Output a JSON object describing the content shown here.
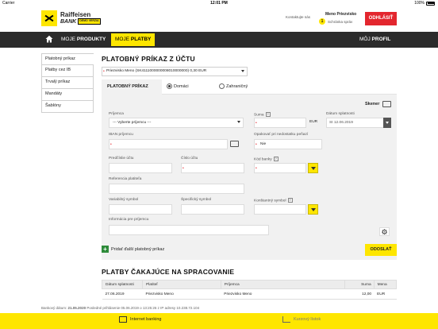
{
  "statusbar": {
    "carrier": "Carrier",
    "time": "12:01 PM",
    "battery": "100%"
  },
  "brand": {
    "line1": "Raiffeisen",
    "line2": "BANK",
    "badge": "DEMO VERZIA"
  },
  "header": {
    "contact": "Kontaktujte nás",
    "user_name": "Meno Priezvisko",
    "message_count": "1",
    "inbox": "Schránka správ",
    "logout": "ODHLÁSIŤ"
  },
  "nav": {
    "products_prefix": "MOJE",
    "products_bold": "PRODUKTY",
    "payments_prefix": "MOJE",
    "payments_bold": "PLATBY",
    "profile_prefix": "MÔJ",
    "profile_bold": "PROFIL"
  },
  "sidebar": {
    "items": [
      {
        "label": "Platobný príkaz"
      },
      {
        "label": "Platby cez IB"
      },
      {
        "label": "Trvalý príkaz"
      },
      {
        "label": "Mandáty"
      },
      {
        "label": "Šablóny"
      }
    ]
  },
  "main": {
    "title": "PLATOBNÝ PRÍKAZ Z ÚČTU",
    "account": "Priezvisko Meno (SK4111000000008010000000) 0,30 EUR",
    "form_tab": "PLATOBNÝ PRÍKAZ",
    "radio_domestic": "Domáci",
    "radio_foreign": "Zahraničný",
    "scanner": "Skener",
    "recipient_label": "Príjemca",
    "recipient_value": "--- Vyberte príjemcu ---",
    "iban_label": "IBAN príjemcu",
    "prefix_label": "Predčíslie účtu",
    "account_number_label": "Číslo účtu",
    "bank_code_label": "Kód banky",
    "reference_label": "Referencia platiteľa",
    "variable_symbol_label": "Variabilný symbol",
    "specific_symbol_label": "Špecifický symbol",
    "constant_symbol_label": "Konštantný symbol",
    "info_label": "Informácia pre príjemcu",
    "amount_label": "Suma",
    "currency": "EUR",
    "due_date_label": "Dátum splatnosti",
    "due_date_value": "St 12.06.2019",
    "retry_label": "Opakovať pri nedostatku peňazí",
    "retry_value": "Nie",
    "add_payment": "Pridať ďalší platobný príkaz",
    "send": "ODOSLAŤ"
  },
  "pending": {
    "title": "PLATBY ČAKAJÚCE NA SPRACOVANIE",
    "columns": [
      "Dátum splatnosti",
      "Platiteľ",
      "Príjemca",
      "Suma",
      "Mena"
    ],
    "rows": [
      [
        "27.06.2019",
        "Priezvisko Meno",
        "Priezvisko Meno",
        "12,00",
        "EUR"
      ]
    ]
  },
  "footer": {
    "bank_date_label": "Bankový dátum:",
    "bank_date": "21.05.2020",
    "last_login": "Posledné prihlásenie 05.06.2019 o 13:25:26 z IP adresy 10.238.72.104",
    "internet_banking": "Internet banking",
    "exchange_rates": "Kurzový lístok"
  },
  "colors": {
    "brand_yellow": "#fee600",
    "logout_red": "#e3262e",
    "nav_dark": "#2b2b2b"
  }
}
